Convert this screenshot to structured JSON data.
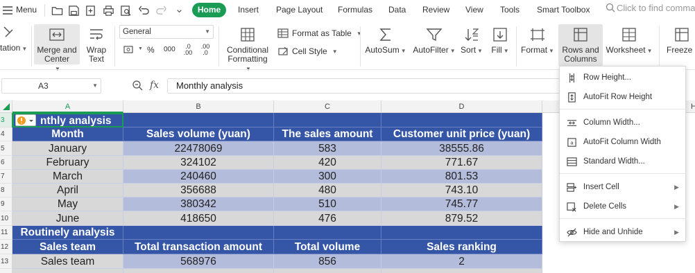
{
  "topbar": {
    "menu_label": "Menu",
    "tabs": [
      "Home",
      "Insert",
      "Page Layout",
      "Formulas",
      "Data",
      "Review",
      "View",
      "Tools",
      "Smart Toolbox"
    ],
    "search_placeholder": "Click to find comma"
  },
  "ribbon": {
    "truncated_left_label": "tation",
    "merge_center": "Merge and Center",
    "wrap_text": "Wrap Text",
    "number_format": "General",
    "percent": "%",
    "thousands": "000",
    "inc_decimal": ".0 .00",
    "dec_decimal": ".00 .0",
    "conditional_formatting": "Conditional Formatting",
    "format_as_table": "Format as Table",
    "cell_style": "Cell Style",
    "autosum": "AutoSum",
    "autofilter": "AutoFilter",
    "sort": "Sort",
    "fill": "Fill",
    "format": "Format",
    "rows_and_columns": "Rows and Columns",
    "worksheet": "Worksheet",
    "freeze_truncated": "Freeze P"
  },
  "formula_bar": {
    "name_box": "A3",
    "fx_label": "fx",
    "formula_value": "Monthly analysis"
  },
  "grid": {
    "columns": [
      "A",
      "B",
      "C",
      "D"
    ],
    "right_col_partial": "H",
    "rows": [
      "3",
      "4",
      "5",
      "6",
      "7",
      "8",
      "9",
      "10",
      "11",
      "12",
      "13"
    ],
    "a3_visible_text": "nthly analysis",
    "header1": [
      "Month",
      "Sales volume (yuan)",
      "The sales amount",
      "Customer unit price (yuan)"
    ],
    "data1": [
      [
        "January",
        "22478069",
        "583",
        "38555.86"
      ],
      [
        "February",
        "324102",
        "420",
        "771.67"
      ],
      [
        "March",
        "240460",
        "300",
        "801.53"
      ],
      [
        "April",
        "356688",
        "480",
        "743.10"
      ],
      [
        "May",
        "380342",
        "510",
        "745.77"
      ],
      [
        "June",
        "418650",
        "476",
        "879.52"
      ]
    ],
    "section2_title": "Routinely analysis",
    "header2": [
      "Sales team",
      "Total transaction amount",
      "Total volume",
      "Sales ranking"
    ],
    "data2": [
      [
        "Sales team",
        "568976",
        "856",
        "2"
      ]
    ]
  },
  "context_menu": {
    "items": [
      {
        "label": "Row Height...",
        "icon": "row-height-icon"
      },
      {
        "label": "AutoFit Row Height",
        "icon": "autofit-row-height-icon"
      },
      {
        "label": "Column Width...",
        "icon": "column-width-icon"
      },
      {
        "label": "AutoFit Column Width",
        "icon": "autofit-column-width-icon"
      },
      {
        "label": "Standard Width...",
        "icon": "standard-width-icon"
      },
      {
        "label": "Insert Cell",
        "icon": "insert-cell-icon",
        "submenu": true
      },
      {
        "label": "Delete Cells",
        "icon": "delete-cells-icon",
        "submenu": true
      },
      {
        "label": "Hide and Unhide",
        "icon": "hide-unhide-icon",
        "submenu": true
      }
    ]
  },
  "colors": {
    "home_tab": "#1a9c55",
    "header_fill": "#3556a6",
    "band_blue": "#b4bcdb",
    "band_gray": "#d8d8d8",
    "selection_green": "#1a9c55"
  }
}
